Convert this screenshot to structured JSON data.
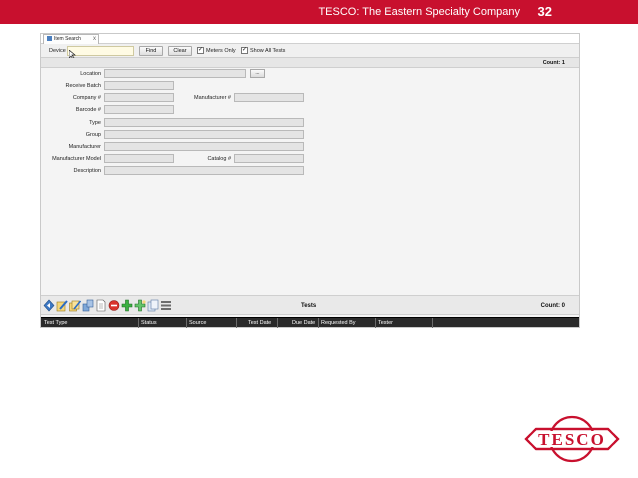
{
  "slide": {
    "header_title": "TESCO: The Eastern Specialty Company",
    "slide_number": "32",
    "brand_color": "#c8102e"
  },
  "tab": {
    "label": "Item Search",
    "close": "x"
  },
  "toolbar": {
    "device_label": "Device",
    "device_value": "",
    "find_label": "Find",
    "clear_label": "Clear",
    "meters_only_label": "Meters Only",
    "meters_only_checked": "✓",
    "show_all_tests_label": "Show All Tests",
    "show_all_tests_checked": "✓"
  },
  "results": {
    "count_text": "Count: 1"
  },
  "form": {
    "location_label": "Location",
    "location_button": "...",
    "receive_batch_label": "Receive Batch",
    "company_label": "Company #",
    "manufacturer_num_label": "Manufacturer #",
    "barcode_label": "Barcode #",
    "type_label": "Type",
    "group_label": "Group",
    "manufacturer_label": "Manufacturer",
    "manufacturer_model_label": "Manufacturer Model",
    "catalog_label": "Catalog #",
    "description_label": "Description"
  },
  "tests_panel": {
    "title": "Tests",
    "count_text": "Count: 0",
    "icons": [
      "navigate-icon",
      "edit-icon",
      "edit-multiple-icon",
      "transfer-icon",
      "document-icon",
      "remove-icon",
      "add-icon",
      "add-multiple-icon",
      "copy-icon",
      "list-icon"
    ],
    "columns": [
      "Test Type",
      "Status",
      "Source",
      "Test Date",
      "Due Date",
      "Requested By",
      "Tester"
    ]
  },
  "logo": {
    "text": "TESCO"
  }
}
